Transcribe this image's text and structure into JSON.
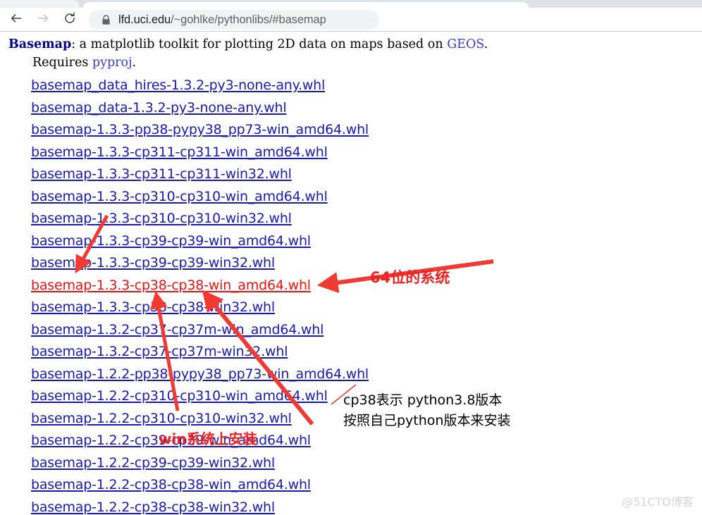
{
  "browser": {
    "tab_strip_color": "#dee1e6",
    "back_icon": "arrow-left-icon",
    "forward_icon": "arrow-right-icon",
    "reload_icon": "reload-icon",
    "lock_icon": "lock-icon",
    "url_host": "lfd.uci.edu",
    "url_path": "/~gohlke/pythonlibs/#basemap"
  },
  "page": {
    "intro": {
      "package": "Basemap",
      "desc_before_link": ": a matplotlib toolkit for plotting 2D data on maps based on ",
      "geos_link": "GEOS",
      "desc_after_link": ".",
      "requires_prefix": "Requires ",
      "requires_link": "pyproj",
      "requires_suffix": "."
    },
    "link_color": "#1a1ab0",
    "highlight_color": "#ee1111",
    "files": [
      {
        "name": "basemap_data_hires-1.3.2-py3-none-any.whl",
        "highlight": false
      },
      {
        "name": "basemap_data-1.3.2-py3-none-any.whl",
        "highlight": false
      },
      {
        "name": "basemap-1.3.3-pp38-pypy38_pp73-win_amd64.whl",
        "highlight": false
      },
      {
        "name": "basemap-1.3.3-cp311-cp311-win_amd64.whl",
        "highlight": false
      },
      {
        "name": "basemap-1.3.3-cp311-cp311-win32.whl",
        "highlight": false
      },
      {
        "name": "basemap-1.3.3-cp310-cp310-win_amd64.whl",
        "highlight": false
      },
      {
        "name": "basemap-1.3.3-cp310-cp310-win32.whl",
        "highlight": false
      },
      {
        "name": "basemap-1.3.3-cp39-cp39-win_amd64.whl",
        "highlight": false
      },
      {
        "name": "basemap-1.3.3-cp39-cp39-win32.whl",
        "highlight": false
      },
      {
        "name": "basemap-1.3.3-cp38-cp38-win_amd64.whl",
        "highlight": true
      },
      {
        "name": "basemap-1.3.3-cp38-cp38-win32.whl",
        "highlight": false
      },
      {
        "name": "basemap-1.3.2-cp37-cp37m-win_amd64.whl",
        "highlight": false
      },
      {
        "name": "basemap-1.3.2-cp37-cp37m-win32.whl",
        "highlight": false
      },
      {
        "name": "basemap-1.2.2-pp38-pypy38_pp73-win_amd64.whl",
        "highlight": false
      },
      {
        "name": "basemap-1.2.2-cp310-cp310-win_amd64.whl",
        "highlight": false
      },
      {
        "name": "basemap-1.2.2-cp310-cp310-win32.whl",
        "highlight": false
      },
      {
        "name": "basemap-1.2.2-cp39-cp39-win_amd64.whl",
        "highlight": false
      },
      {
        "name": "basemap-1.2.2-cp39-cp39-win32.whl",
        "highlight": false
      },
      {
        "name": "basemap-1.2.2-cp38-cp38-win_amd64.whl",
        "highlight": false
      },
      {
        "name": "basemap-1.2.2-cp38-cp38-win32.whl",
        "highlight": false
      }
    ]
  },
  "annotations": {
    "color_red": "#ee2222",
    "note_64bit": "64位的系统",
    "note_win": "win系统上安装",
    "note_black_line1": "cp38表示 python3.8版本",
    "note_black_line2": "按照自己python版本来安装"
  },
  "watermark": "@51CTO博客"
}
